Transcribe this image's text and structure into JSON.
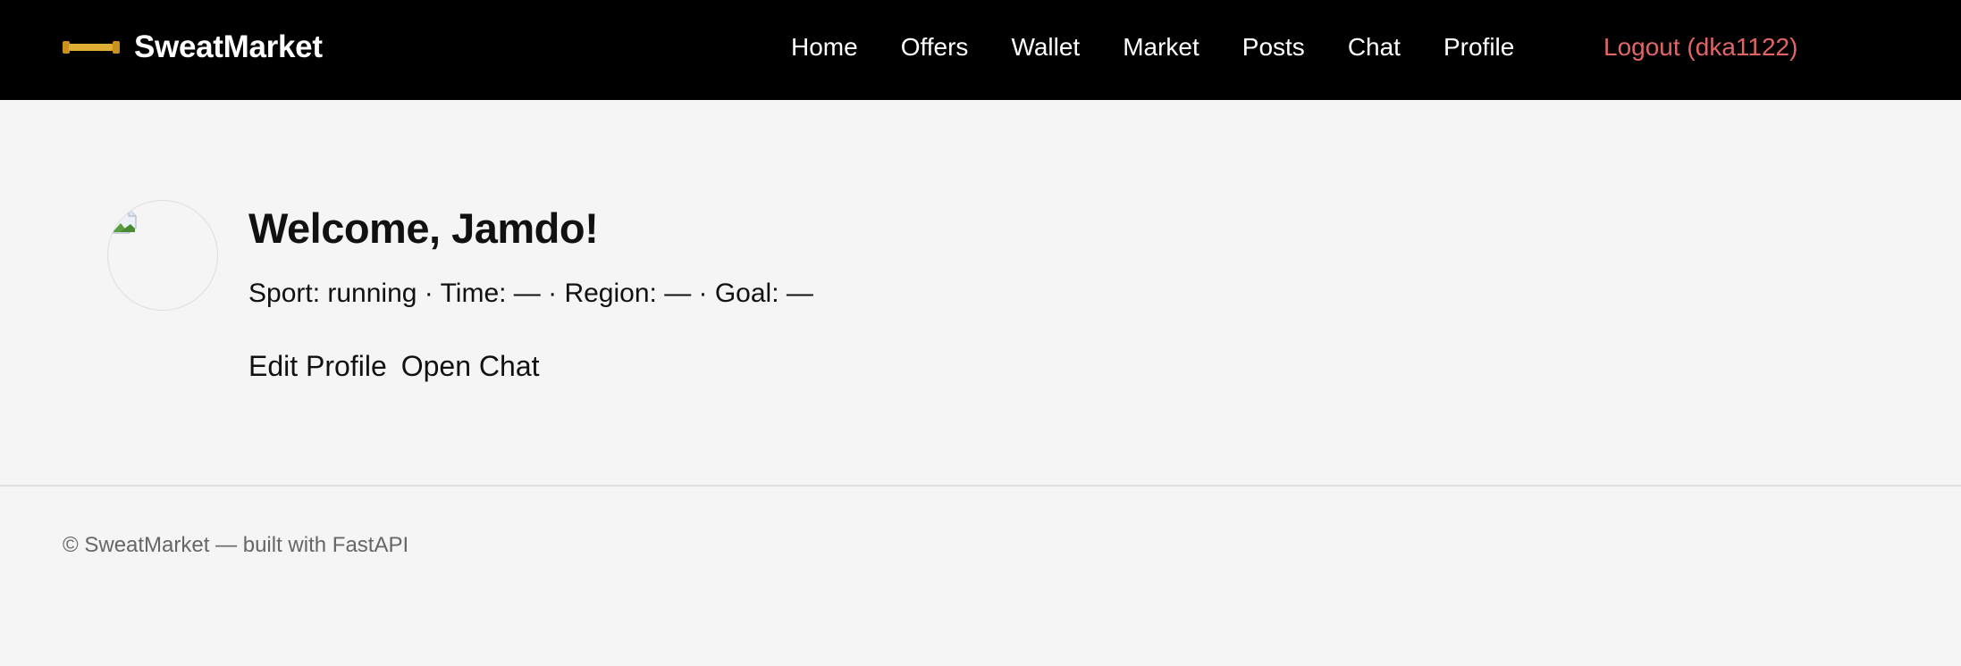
{
  "header": {
    "brand": "SweatMarket",
    "brand_icon": "dumbbell-icon",
    "nav": [
      "Home",
      "Offers",
      "Wallet",
      "Market",
      "Posts",
      "Chat",
      "Profile"
    ],
    "logout": "Logout (dka1122)"
  },
  "profile": {
    "avatar_icon": "broken-image-icon",
    "welcome": "Welcome, Jamdo!",
    "meta": "Sport: running · Time: — · Region: — · Goal: —",
    "edit_profile": "Edit Profile",
    "open_chat": "Open Chat"
  },
  "footer": {
    "text": "© SweatMarket — built with FastAPI"
  },
  "colors": {
    "header_bg": "#000000",
    "page_bg": "#f5f5f5",
    "logout": "#e06666",
    "brand_icon": "#d9a526"
  }
}
